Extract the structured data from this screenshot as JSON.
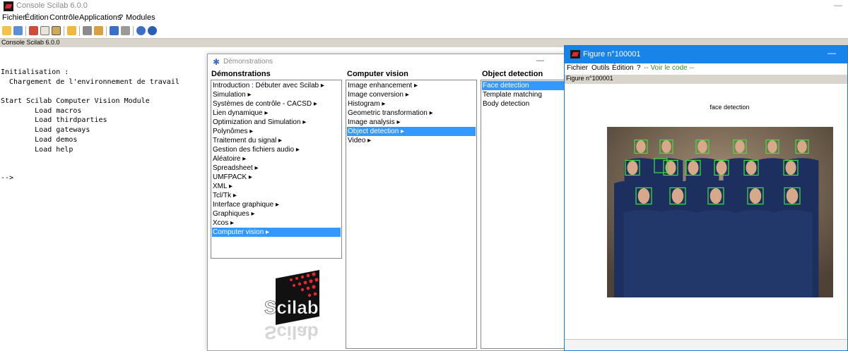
{
  "window": {
    "title": "Console Scilab 6.0.0",
    "minimize": "—"
  },
  "menubar": [
    "Fichier",
    "Édition",
    "Contrôle",
    "Applications",
    "?",
    "Modules"
  ],
  "toolbar_icons": [
    "new-script-icon",
    "open-file-icon",
    "cut-icon",
    "copy-icon",
    "paste-icon",
    "clear-icon",
    "print-icon",
    "browser-icon",
    "console-icon",
    "modules-icon",
    "demos-icon",
    "help-icon"
  ],
  "console_tab": "Console Scilab 6.0.0",
  "console_lines": [
    "Initialisation :",
    "  Chargement de l'environnement de travail",
    "",
    "Start Scilab Computer Vision Module",
    "        Load macros",
    "        Load thirdparties",
    "        Load gateways",
    "        Load demos",
    "        Load help",
    "",
    "",
    "-->"
  ],
  "demo": {
    "title": "Démonstrations",
    "minimize": "—",
    "col1_header": "Démonstrations",
    "col2_header": "Computer vision",
    "col3_header": "Object detection",
    "col1_items": [
      "Introduction : Débuter avec Scilab ▸",
      "Simulation ▸",
      "Systèmes de contrôle - CACSD ▸",
      "Lien dynamique ▸",
      "Optimization and Simulation ▸",
      "Polynômes ▸",
      "Traitement du signal ▸",
      "Gestion des fichiers audio ▸",
      "Aléatoire ▸",
      "Spreadsheet ▸",
      "UMFPACK ▸",
      "XML ▸",
      "Tcl/Tk ▸",
      "Interface graphique ▸",
      "Graphiques ▸",
      "Xcos ▸",
      "Computer vision ▸"
    ],
    "col1_selected": 16,
    "col2_items": [
      "Image enhancement ▸",
      "Image conversion ▸",
      "Histogram ▸",
      "Geometric transformation ▸",
      "Image analysis ▸",
      "Object detection ▸",
      "Video ▸"
    ],
    "col2_selected": 5,
    "col3_items": [
      "Face detection",
      "Template matching",
      "Body detection"
    ],
    "col3_selected": 0,
    "logo_text": "Scilab"
  },
  "figure": {
    "title": "Figure n°100001",
    "minimize": "—",
    "menu": [
      "Fichier",
      "Outils",
      "Édition",
      "?",
      "-- Voir le code --"
    ],
    "status": "Figure n°100001",
    "plot_title": "face detection",
    "detection_color": "#39e639"
  },
  "colors": {
    "selection": "#3399ff",
    "figure_titlebar": "#1883e8",
    "status_bg": "#d9d5cc"
  }
}
